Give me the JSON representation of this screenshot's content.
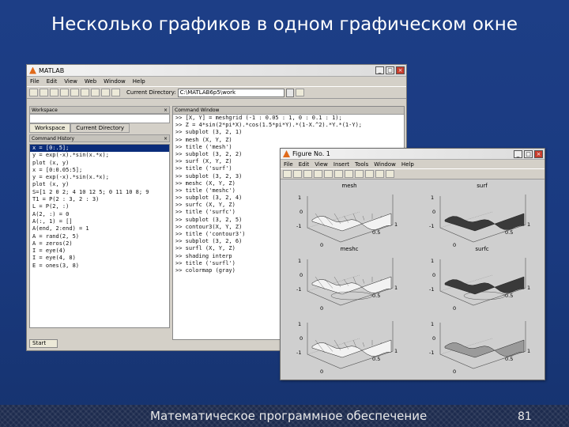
{
  "slide": {
    "title": "Несколько графиков в одном графическом окне",
    "footer": "Математическое программное обеспечение",
    "page_number": "81"
  },
  "matlab": {
    "window_title": "MATLAB",
    "menu": [
      "File",
      "Edit",
      "View",
      "Web",
      "Window",
      "Help"
    ],
    "current_directory_label": "Current Directory:",
    "current_directory": "C:\\MATLAB6p5\\work",
    "workspace_title": "Workspace",
    "tabs": [
      "Workspace",
      "Current Directory"
    ],
    "history_title": "Command History",
    "history": [
      "x = [0:.5];",
      "y = exp(-x).*sin(x.*x);",
      "plot (x, y)",
      "x = [0:0.05:5];",
      "y = exp(-x).*sin(x.*x);",
      "plot (x, y)",
      "S=[1 2 0 2; 4 10 12 5; 0 11 10 8; 9",
      "T1 = P(2 : 3, 2 : 3)",
      "L = P(2, :)",
      "A(2, :) = 0",
      "A(:, 1) = []",
      "A(end, 2:end) = 1",
      "A = rand(2, 5)",
      "A = zeros(2)",
      "I = eye(4)",
      "I = eye(4, 8)",
      "E = ones(3, 8)"
    ],
    "start_label": "Start",
    "command_window_title": "Command Window",
    "commands": [
      ">> [X, Y] = meshgrid (-1 : 0.05 : 1, 0 : 0.1 : 1);",
      ">> Z = 4*sin(2*pi*X).*cos(1.5*pi*Y).*(1-X.^2).*Y.*(1-Y);",
      ">> subplot (3, 2, 1)",
      ">> mesh (X, Y, Z)",
      ">> title ('mesh')",
      ">> subplot (3, 2, 2)",
      ">> surf (X, Y, Z)",
      ">> title ('surf')",
      ">> subplot (3, 2, 3)",
      ">> meshc (X, Y, Z)",
      ">> title ('meshc')",
      ">> subplot (3, 2, 4)",
      ">> surfc (X, Y, Z)",
      ">> title ('surfc')",
      ">> subplot (3, 2, 5)",
      ">> contour3(X, Y, Z)",
      ">> title ('contour3')",
      ">> subplot (3, 2, 6)",
      ">> surfl (X, Y, Z)",
      ">> shading interp",
      ">> title ('surfl')",
      ">> colormap (gray)"
    ]
  },
  "figure": {
    "window_title": "Figure No. 1",
    "menu": [
      "File",
      "Edit",
      "View",
      "Insert",
      "Tools",
      "Window",
      "Help"
    ],
    "plots": [
      {
        "title": "mesh",
        "style": "wire"
      },
      {
        "title": "surf",
        "style": "solid"
      },
      {
        "title": "meshc",
        "style": "wire"
      },
      {
        "title": "surfc",
        "style": "solid"
      },
      {
        "title": "",
        "style": "contour"
      },
      {
        "title": "",
        "style": "smooth"
      }
    ],
    "tick_labels": {
      "z_top": "1",
      "z_mid": "0",
      "z_bottom": "-1",
      "y": "0.5",
      "x": "1",
      "x0": "0"
    }
  }
}
